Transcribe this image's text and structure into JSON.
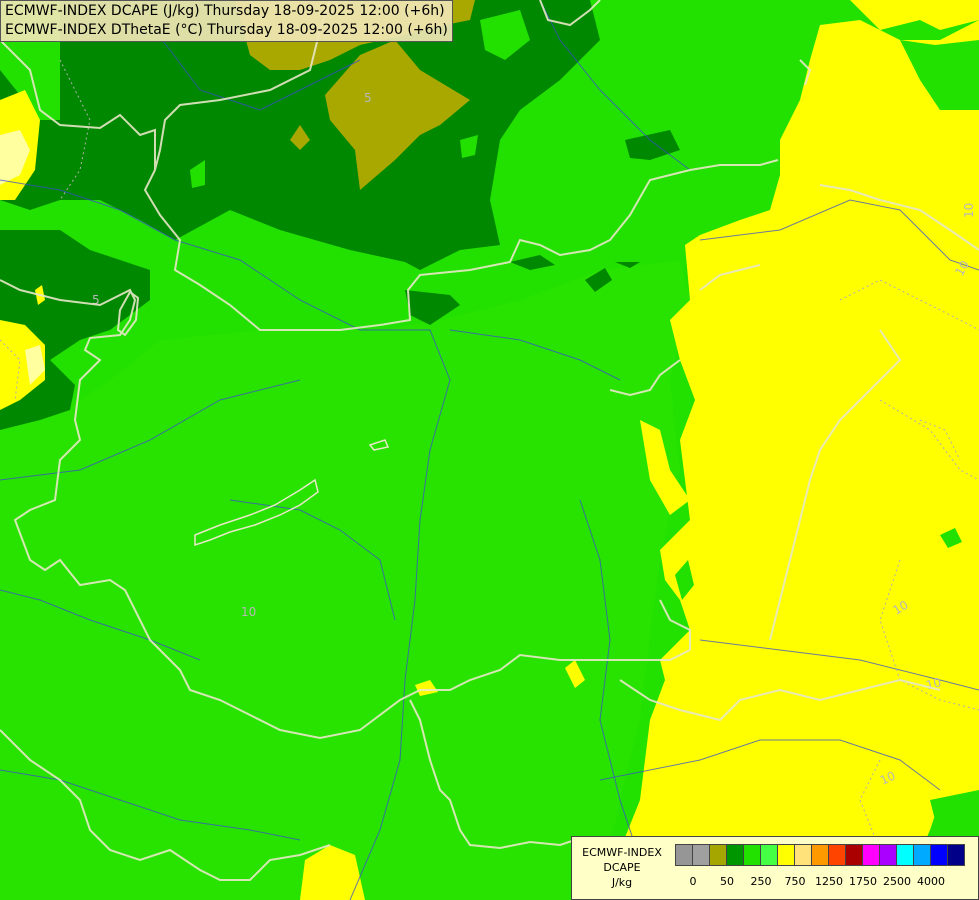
{
  "title": {
    "line1": "ECMWF-INDEX DCAPE (J/kg) Thursday 18-09-2025 12:00 (+6h)",
    "line2": "ECMWF-INDEX DThetaE (°C) Thursday 18-09-2025 12:00 (+6h)"
  },
  "legend": {
    "line1": "ECMWF-INDEX",
    "line2": "DCAPE",
    "line3": "J/kg",
    "colors": [
      "#969696",
      "#a0a0a0",
      "#a6a600",
      "#009600",
      "#22e000",
      "#44ff44",
      "#ffff00",
      "#ffe37a",
      "#ff9900",
      "#ff4400",
      "#aa0000",
      "#ff00ff",
      "#aa00ff",
      "#00ffff",
      "#00aaff",
      "#0000ff",
      "#000088"
    ],
    "tick_labels": [
      "0",
      "50",
      "250",
      "750",
      "1250",
      "1750",
      "2500",
      "4000"
    ]
  },
  "contour_labels": [
    "10",
    "10",
    "10",
    "10",
    "5",
    "10",
    "10",
    "5"
  ],
  "colors": {
    "dark_green": "#008800",
    "green": "#22e000",
    "light_green": "#44ee00",
    "olive": "#a8a800",
    "yellow": "#ffff00",
    "pale_yellow": "#ffff90",
    "border": "#e8e8d0",
    "river": "#3a4ecf"
  }
}
